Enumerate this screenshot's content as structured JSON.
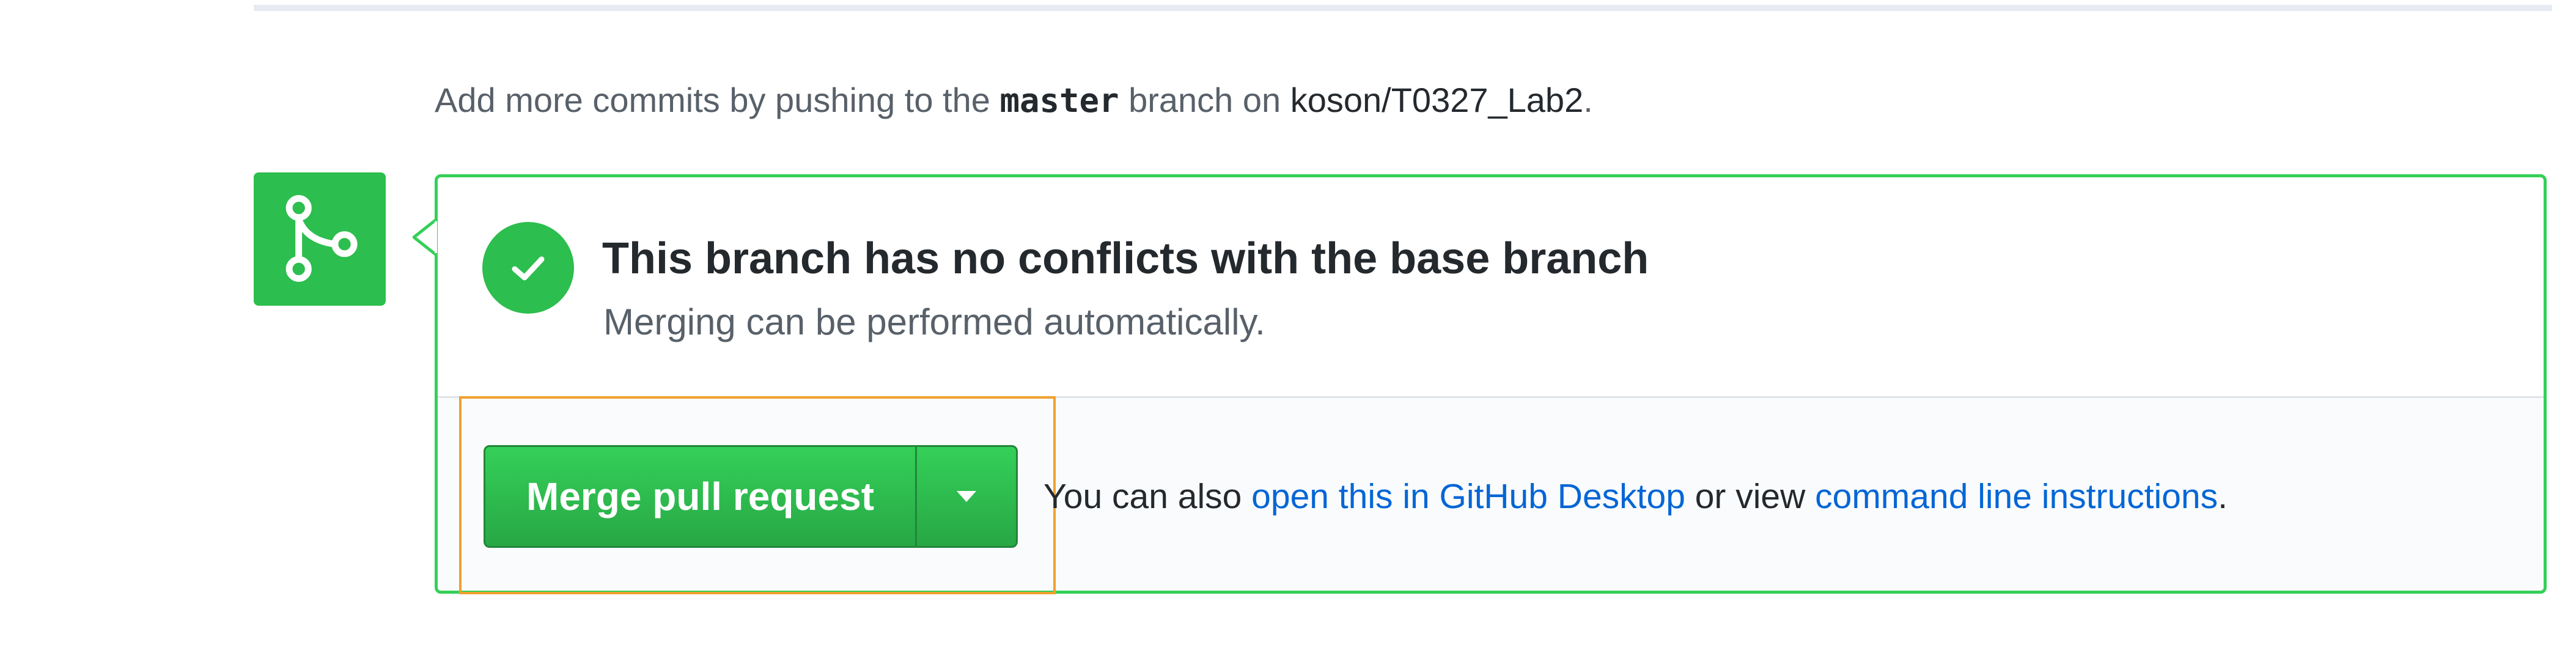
{
  "commits_hint": {
    "prefix": "Add more commits by pushing to the ",
    "branch": "master",
    "middle": " branch on ",
    "repo": "koson/T0327_Lab2",
    "suffix": "."
  },
  "merge_status": {
    "title": "This branch has no conflicts with the base branch",
    "subtitle": "Merging can be performed automatically."
  },
  "merge_actions": {
    "merge_button_label": "Merge pull request",
    "also_prefix": "You can also ",
    "desktop_link": "open this in GitHub Desktop",
    "also_middle": " or view ",
    "cli_link": "command line instructions",
    "also_suffix": "."
  },
  "colors": {
    "success_green": "#2cbe4e",
    "panel_border": "#34d058",
    "link_blue": "#0366d6",
    "highlight_orange": "#f0a030"
  },
  "icons": {
    "merge": "git-merge-icon",
    "status": "check-icon",
    "dropdown": "triangle-down-icon"
  }
}
